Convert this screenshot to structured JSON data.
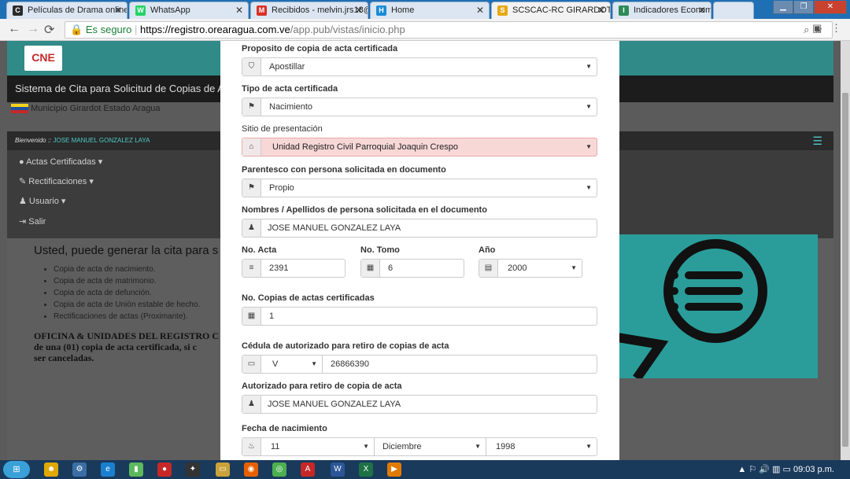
{
  "browser": {
    "tabs": [
      {
        "title": "Películas de Drama online",
        "icon": "C",
        "color": "#2b2b2b"
      },
      {
        "title": "WhatsApp",
        "icon": "W",
        "color": "#25d366"
      },
      {
        "title": "Recibidos - melvin.jrs18@",
        "icon": "M",
        "color": "#d93025"
      },
      {
        "title": "Home",
        "icon": "H",
        "color": "#1b8bd6"
      },
      {
        "title": "SCSCAC-RC GIRARDOT",
        "icon": "S",
        "color": "#e6a817"
      },
      {
        "title": "Indicadores Economía Ve",
        "icon": "I",
        "color": "#2e8b57"
      }
    ],
    "secure_label": "Es seguro",
    "url_host": "https://registro.orearagua.com.ve",
    "url_path": "/app.pub/vistas/inicio.php"
  },
  "site": {
    "logo": "CNE",
    "title": "Sistema de Cita para Solicitud de Copias de Ac",
    "municipio": "Municipio Girardot Estado Aragua",
    "welcome_prefix": "Bienvenido ::",
    "user": "JOSE MANUEL GONZALEZ LAYA",
    "menu": [
      "Actas Certificadas",
      "Rectificaciones",
      "Usuario",
      "Salir"
    ],
    "heading": "Usted, puede generar la cita para s",
    "list": [
      "Copia de acta de nacimiento.",
      "Copia de acta de matrimonio.",
      "Copia de acta de defunción.",
      "Copia de acta de Unión estable de hecho.",
      "Rectificaciones de actas (Proximante)."
    ],
    "oficina": [
      "OFICINA & UNIDADES DEL REGISTRO C",
      "de una (01) copia de acta certificada, si c",
      "ser canceladas."
    ]
  },
  "form": {
    "proposito_label": "Proposito de copia de acta certificada",
    "proposito_value": "Apostillar",
    "tipo_label": "Tipo de acta certificada",
    "tipo_value": "Nacimiento",
    "sitio_label": "Sitio de presentación",
    "sitio_value": "Unidad Registro Civil Parroquial Joaquin Crespo",
    "parentesco_label": "Parentesco con persona solicitada en documento",
    "parentesco_value": "Propio",
    "nombres_label": "Nombres / Apellidos de persona solicitada en el documento",
    "nombres_value": "JOSE MANUEL GONZALEZ LAYA",
    "acta_label": "No. Acta",
    "acta_value": "2391",
    "tomo_label": "No. Tomo",
    "tomo_value": "6",
    "anio_label": "Año",
    "anio_value": "2000",
    "copias_label": "No. Copias de actas certificadas",
    "copias_value": "1",
    "cedula_label": "Cédula de autorizado para retiro de copias de acta",
    "cedula_tipo": "V",
    "cedula_value": "26866390",
    "autorizado_label": "Autorizado para retiro de copia de acta",
    "autorizado_value": "JOSE MANUEL GONZALEZ LAYA",
    "fecha_label": "Fecha de nacimiento",
    "fecha_dia": "11",
    "fecha_mes": "Diciembre",
    "fecha_anio": "1998"
  },
  "taskbar": {
    "clock": "09:03 p.m."
  }
}
